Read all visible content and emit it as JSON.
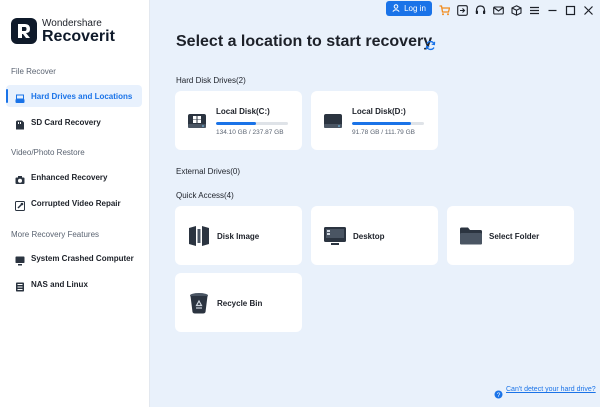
{
  "brand": {
    "line1": "Wondershare",
    "line2": "Recoverit"
  },
  "sidebar": {
    "sections": [
      {
        "title": "File Recover",
        "items": [
          {
            "label": "Hard Drives and Locations",
            "icon": "hard-drive-icon",
            "active": true
          },
          {
            "label": "SD Card Recovery",
            "icon": "sd-card-icon",
            "active": false
          }
        ]
      },
      {
        "title": "Video/Photo Restore",
        "items": [
          {
            "label": "Enhanced Recovery",
            "icon": "camera-icon",
            "active": false
          },
          {
            "label": "Corrupted Video Repair",
            "icon": "video-repair-icon",
            "active": false
          }
        ]
      },
      {
        "title": "More Recovery Features",
        "items": [
          {
            "label": "System Crashed Computer",
            "icon": "computer-icon",
            "active": false
          },
          {
            "label": "NAS and Linux",
            "icon": "nas-icon",
            "active": false
          }
        ]
      }
    ]
  },
  "topbar": {
    "login_label": "Log in",
    "icons": [
      "cart-icon",
      "import-icon",
      "headset-icon",
      "mail-icon",
      "box-icon",
      "menu-icon",
      "minimize-icon",
      "maximize-icon",
      "close-icon"
    ]
  },
  "main": {
    "title": "Select a location to start recovery",
    "hard_disk_title": "Hard Disk Drives(2)",
    "disks": [
      {
        "name": "Local Disk(C:)",
        "size": "134.10 GB / 237.87 GB",
        "used_fraction": 0.56,
        "icon": "windows-disk-icon"
      },
      {
        "name": "Local Disk(D:)",
        "size": "91.78 GB / 111.79 GB",
        "used_fraction": 0.82,
        "icon": "disk-icon"
      }
    ],
    "external_title": "External Drives(0)",
    "quick_title": "Quick Access(4)",
    "quick": [
      {
        "label": "Disk Image",
        "icon": "disk-image-icon"
      },
      {
        "label": "Desktop",
        "icon": "desktop-icon"
      },
      {
        "label": "Select Folder",
        "icon": "folder-icon"
      },
      {
        "label": "Recycle Bin",
        "icon": "recycle-bin-icon"
      }
    ],
    "help_link": "Can't detect your hard drive?"
  },
  "colors": {
    "accent": "#1a73e8",
    "background": "#e9f1fb",
    "card": "#ffffff",
    "dark": "#0f1a2a"
  }
}
